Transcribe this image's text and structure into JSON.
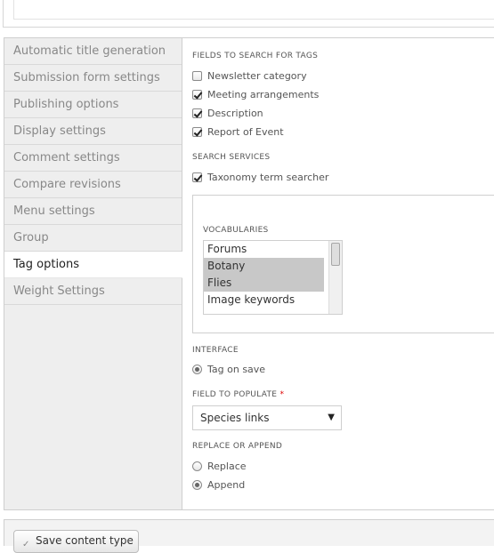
{
  "vertical_tabs": [
    {
      "label": "Automatic title generation",
      "selected": false
    },
    {
      "label": "Submission form settings",
      "selected": false
    },
    {
      "label": "Publishing options",
      "selected": false
    },
    {
      "label": "Display settings",
      "selected": false
    },
    {
      "label": "Comment settings",
      "selected": false
    },
    {
      "label": "Compare revisions",
      "selected": false
    },
    {
      "label": "Menu settings",
      "selected": false
    },
    {
      "label": "Group",
      "selected": false
    },
    {
      "label": "Tag options",
      "selected": true
    },
    {
      "label": "Weight Settings",
      "selected": false
    }
  ],
  "fields_to_search": {
    "title": "FIELDS TO SEARCH FOR TAGS",
    "items": [
      {
        "label": "Newsletter category",
        "checked": false
      },
      {
        "label": "Meeting arrangements",
        "checked": true
      },
      {
        "label": "Description",
        "checked": true
      },
      {
        "label": "Report of Event",
        "checked": true
      }
    ]
  },
  "search_services": {
    "title": "SEARCH SERVICES",
    "items": [
      {
        "label": "Taxonomy term searcher",
        "checked": true
      }
    ]
  },
  "vocabularies": {
    "title": "VOCABULARIES",
    "options": [
      {
        "label": "Forums",
        "selected": false
      },
      {
        "label": "Botany",
        "selected": true
      },
      {
        "label": "Flies",
        "selected": true
      },
      {
        "label": "Image keywords",
        "selected": false
      }
    ]
  },
  "interface": {
    "title": "INTERFACE",
    "options": [
      {
        "label": "Tag on save",
        "checked": true
      }
    ]
  },
  "field_to_populate": {
    "title": "FIELD TO POPULATE",
    "required_marker": "*",
    "value": "Species links",
    "arrow": "▼"
  },
  "replace_or_append": {
    "title": "REPLACE OR APPEND",
    "options": [
      {
        "label": "Replace",
        "checked": false
      },
      {
        "label": "Append",
        "checked": true
      }
    ]
  },
  "actions": {
    "save_label": "Save content type",
    "save_icon": "✓"
  },
  "colors": {
    "tab_bg": "#eeeeee",
    "tab_selected_bg": "#ffffff",
    "required": "#dd0000"
  }
}
